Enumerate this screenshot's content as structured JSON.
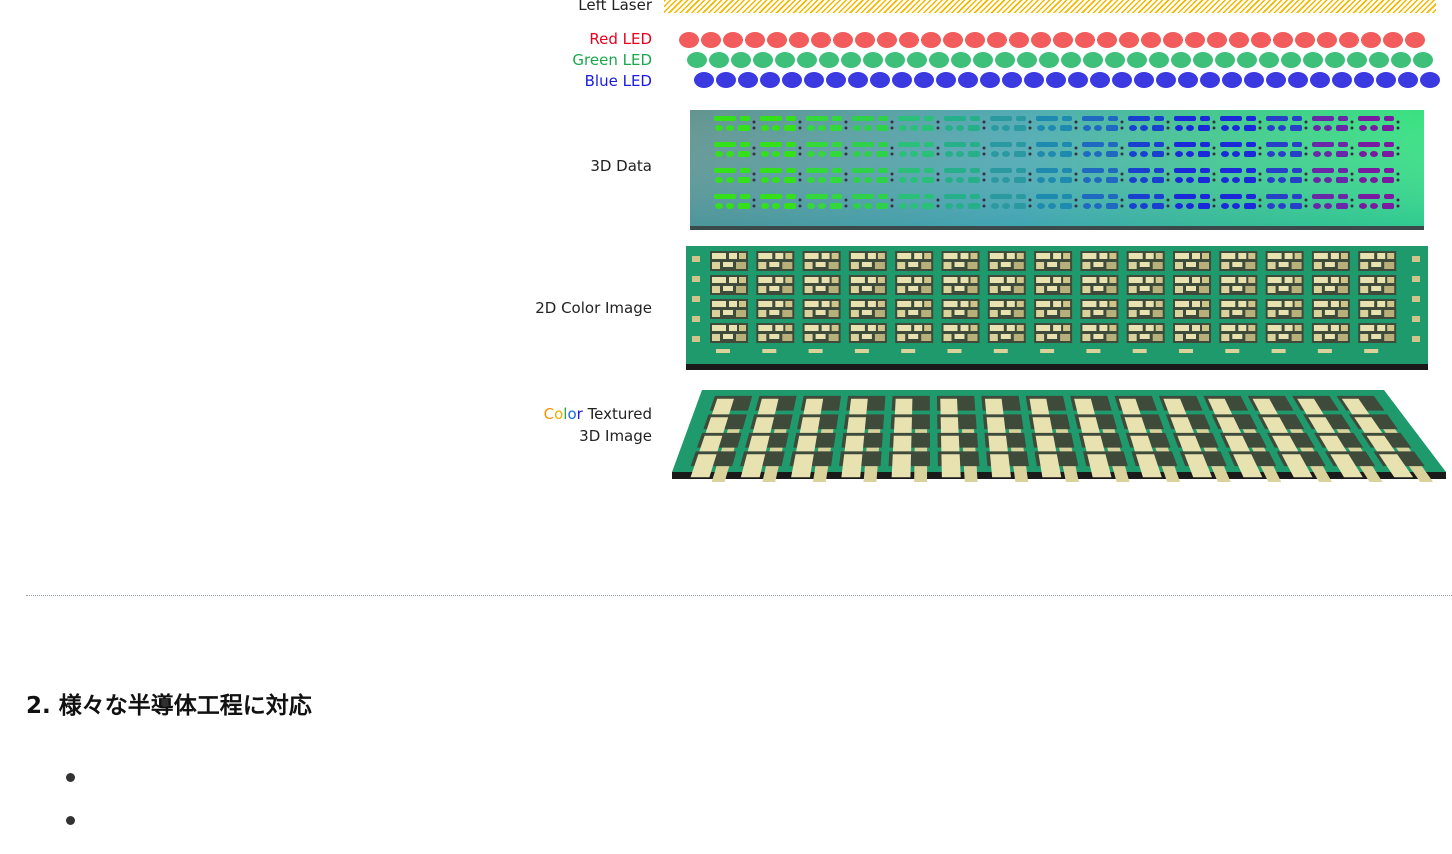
{
  "diagram": {
    "left_laser_label": "Left Laser",
    "red_led_label": "Red LED",
    "green_led_label": "Green LED",
    "blue_led_label": "Blue LED",
    "data_3d_label": "3D Data",
    "color_image_label": "2D Color Image",
    "textured_label": {
      "c": "C",
      "o1": "o",
      "l": "l",
      "o2": "o",
      "r": "r",
      "rest": " Textured",
      "line2": "3D Image"
    },
    "colors": {
      "laser": "#f4b800",
      "red_led": "#f25c5c",
      "green_led": "#3fc07a",
      "blue_led": "#3a3ae0",
      "red_label": "#e8001c",
      "green_label": "#1aa84a",
      "blue_label": "#1a1ae0",
      "board_green": "#1f9a6c"
    }
  },
  "section": {
    "title": "2. 様々な半導体工程に対応",
    "bullets": [
      "",
      ""
    ]
  }
}
